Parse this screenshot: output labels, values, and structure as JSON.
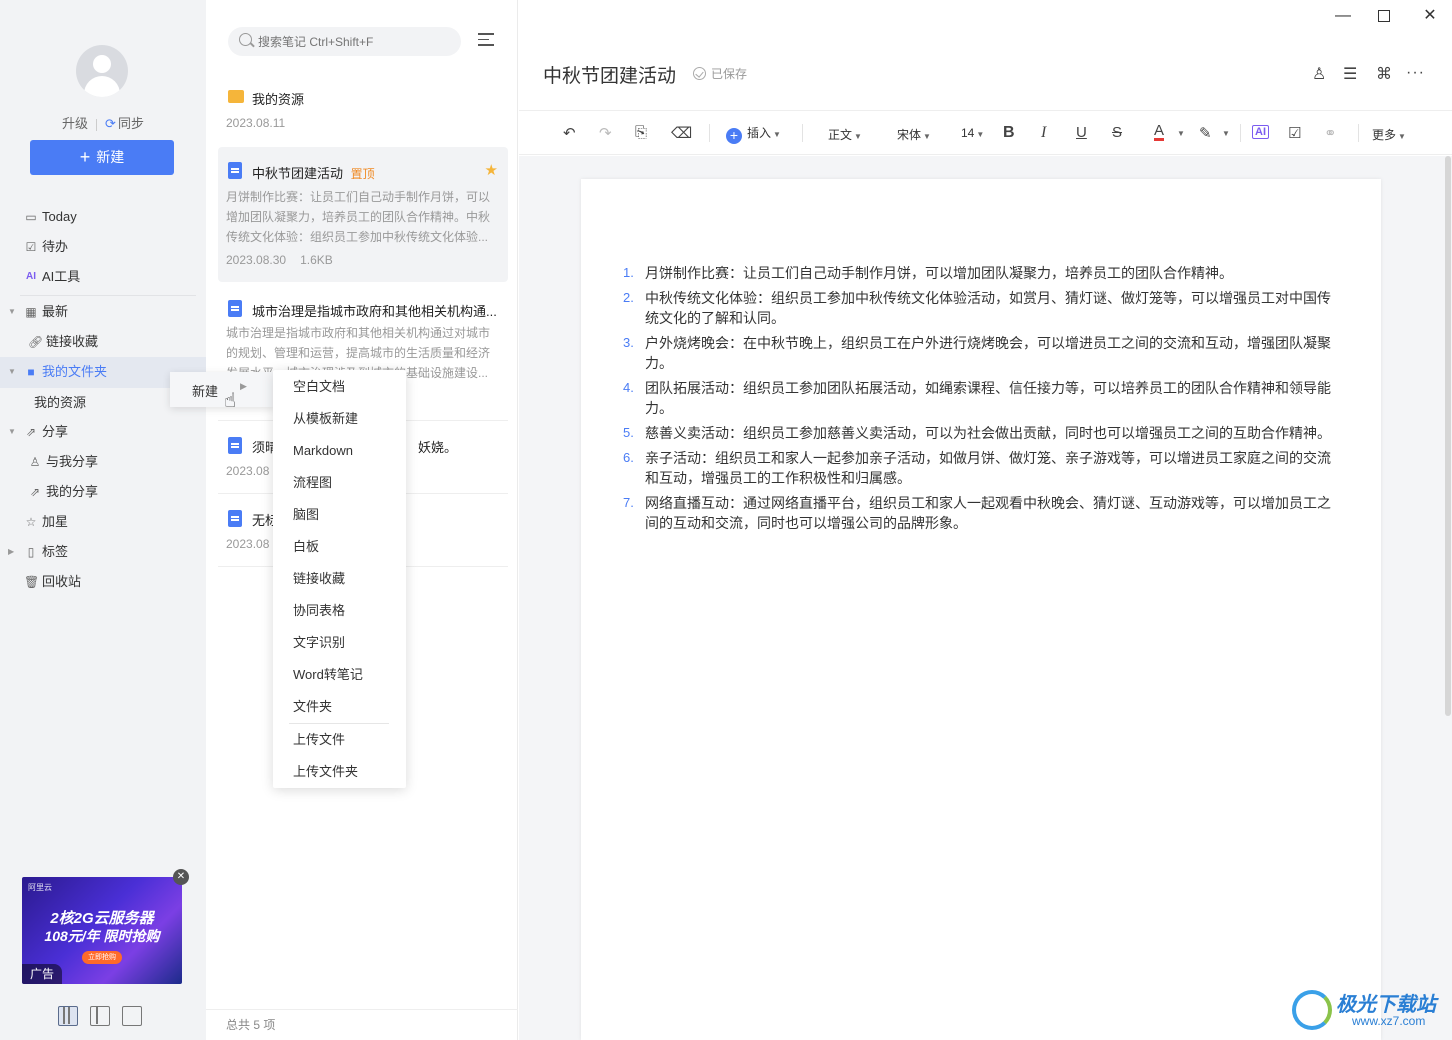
{
  "sidebar": {
    "upgrade_label": "升级",
    "sync_label": "同步",
    "new_button": "新建",
    "nav": {
      "today": "Today",
      "todo": "待办",
      "ai_tools": "AI工具",
      "recent": "最新",
      "link_collect": "链接收藏",
      "my_folder": "我的文件夹",
      "my_resources": "我的资源",
      "share": "分享",
      "shared_with_me": "与我分享",
      "my_share": "我的分享",
      "starred": "加星",
      "tags": "标签",
      "trash": "回收站"
    },
    "ad": {
      "brand": "阿里云",
      "line1": "2核2G云服务器",
      "line2": "108元/年 限时抢购",
      "cta": "立即抢购",
      "tag": "广告"
    }
  },
  "search": {
    "placeholder": "搜索笔记 Ctrl+Shift+F"
  },
  "notes": [
    {
      "title": "我的资源",
      "date": "2023.08.11"
    },
    {
      "title": "中秋节团建活动",
      "badge": "置顶",
      "preview": "月饼制作比赛：让员工们自己动手制作月饼，可以增加团队凝聚力，培养员工的团队合作精神。中秋传统文化体验：组织员工参加中秋传统文化体验...",
      "date": "2023.08.30",
      "size": "1.6KB"
    },
    {
      "title": "城市治理是指城市政府和其他相关机构通...",
      "preview": "城市治理是指城市政府和其他相关机构通过对城市的规划、管理和运营，提高城市的生活质量和经济发展水平，城市治理涉及到城市的基础设施建设..."
    },
    {
      "title": "须晴",
      "title_tail": "妖娆。",
      "date": "2023.08"
    },
    {
      "title": "无标",
      "date": "2023.08"
    }
  ],
  "list_footer": "总共 5 项",
  "context_menu": {
    "parent": "新建",
    "items": [
      "空白文档",
      "从模板新建",
      "Markdown",
      "流程图",
      "脑图",
      "白板",
      "链接收藏",
      "协同表格",
      "文字识别",
      "Word转笔记",
      "文件夹"
    ],
    "upload_items": [
      "上传文件",
      "上传文件夹"
    ]
  },
  "editor": {
    "title": "中秋节团建活动",
    "saved": "已保存",
    "toolbar": {
      "insert": "插入",
      "style": "正文",
      "font": "宋体",
      "size": "14",
      "more": "更多"
    },
    "content": [
      "月饼制作比赛：让员工们自己动手制作月饼，可以增加团队凝聚力，培养员工的团队合作精神。",
      "中秋传统文化体验：组织员工参加中秋传统文化体验活动，如赏月、猜灯谜、做灯笼等，可以增强员工对中国传统文化的了解和认同。",
      "户外烧烤晚会：在中秋节晚上，组织员工在户外进行烧烤晚会，可以增进员工之间的交流和互动，增强团队凝聚力。",
      "团队拓展活动：组织员工参加团队拓展活动，如绳索课程、信任接力等，可以培养员工的团队合作精神和领导能力。",
      "慈善义卖活动：组织员工参加慈善义卖活动，可以为社会做出贡献，同时也可以增强员工之间的互助合作精神。",
      "亲子活动：组织员工和家人一起参加亲子活动，如做月饼、做灯笼、亲子游戏等，可以增进员工家庭之间的交流和互动，增强员工的工作积极性和归属感。",
      "网络直播互动：通过网络直播平台，组织员工和家人一起观看中秋晚会、猜灯谜、互动游戏等，可以增加员工之间的互动和交流，同时也可以增强公司的品牌形象。"
    ]
  },
  "watermark": {
    "name": "极光下载站",
    "url": "www.xz7.com"
  },
  "colors": {
    "accent": "#4a7cf5",
    "star": "#f5b53a",
    "badge": "#f08a24"
  }
}
